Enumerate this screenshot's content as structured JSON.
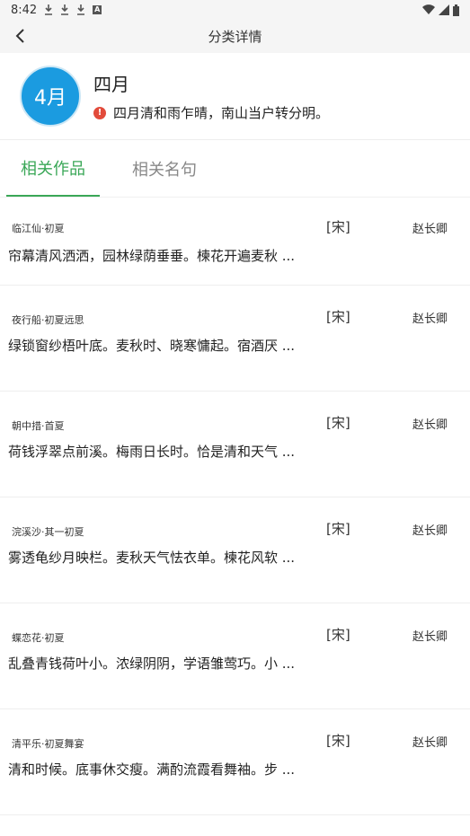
{
  "status_bar": {
    "time": "8:42",
    "icons": [
      "download-icon",
      "download-icon",
      "download-icon",
      "a-icon"
    ],
    "right_icons": [
      "wifi-icon",
      "signal-icon",
      "battery-icon"
    ]
  },
  "app_bar": {
    "title": "分类详情"
  },
  "category": {
    "avatar_text": "4月",
    "name": "四月",
    "description": "四月清和雨乍晴，南山当户转分明。"
  },
  "tabs": [
    {
      "label": "相关作品",
      "active": true
    },
    {
      "label": "相关名句",
      "active": false
    }
  ],
  "poems": [
    {
      "title": "临江仙·初夏",
      "dynasty": "[宋]",
      "author": "赵长卿",
      "excerpt": "帘幕清风洒洒，园林绿荫垂垂。楝花开遍麦秋 ..."
    },
    {
      "title": "夜行船·初夏远思",
      "dynasty": "[宋]",
      "author": "赵长卿",
      "excerpt": "绿锁窗纱梧叶底。麦秋时、晓寒慵起。宿酒厌 ..."
    },
    {
      "title": "朝中措·首夏",
      "dynasty": "[宋]",
      "author": "赵长卿",
      "excerpt": "荷钱浮翠点前溪。梅雨日长时。恰是清和天气 ..."
    },
    {
      "title": "浣溪沙·其一初夏",
      "dynasty": "[宋]",
      "author": "赵长卿",
      "excerpt": "雾透龟纱月映栏。麦秋天气怯衣单。楝花风软 ..."
    },
    {
      "title": "蝶恋花·初夏",
      "dynasty": "[宋]",
      "author": "赵长卿",
      "excerpt": "乱叠青钱荷叶小。浓绿阴阴，学语雏莺巧。小 ..."
    },
    {
      "title": "清平乐·初夏舞宴",
      "dynasty": "[宋]",
      "author": "赵长卿",
      "excerpt": "清和时候。底事休交瘦。满酌流霞看舞袖。步 ..."
    }
  ],
  "colors": {
    "accent": "#3aa757",
    "avatar": "#1b9be0",
    "info": "#e24b3b"
  }
}
